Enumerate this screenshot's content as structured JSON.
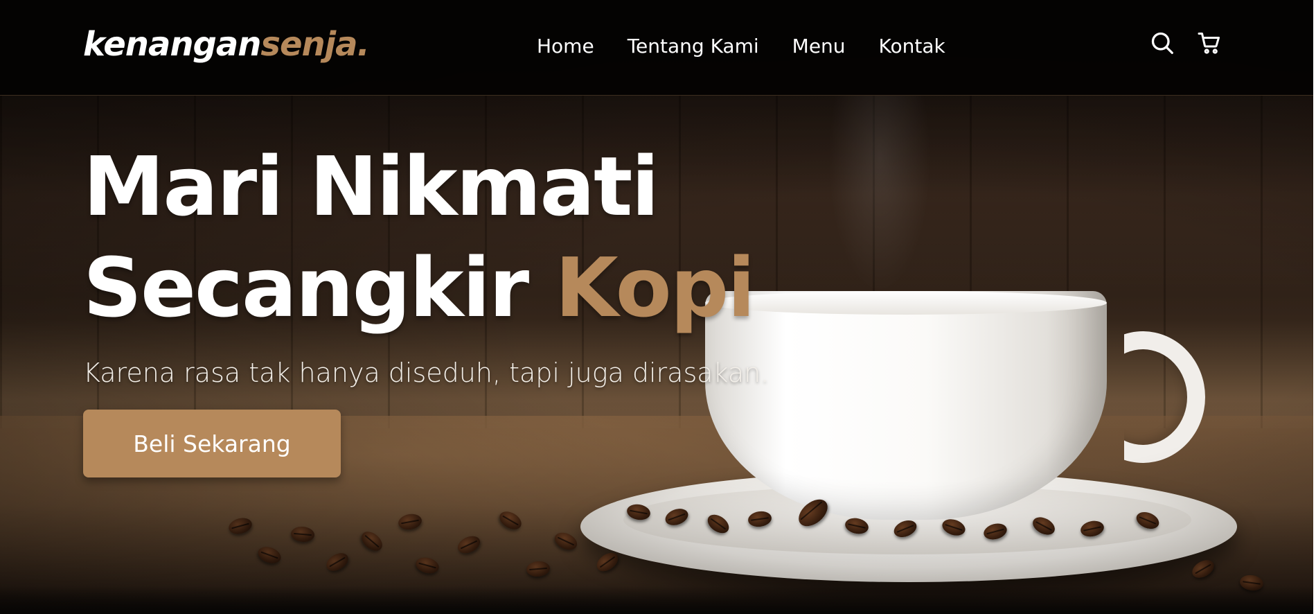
{
  "brand": {
    "name_main": "kenangan",
    "name_accent": "senja",
    "name_dot": ".",
    "accent_color": "#b6895b"
  },
  "nav": {
    "items": [
      {
        "label": "Home"
      },
      {
        "label": "Tentang Kami"
      },
      {
        "label": "Menu"
      },
      {
        "label": "Kontak"
      }
    ],
    "icons": [
      "search-icon",
      "shopping-cart-icon"
    ]
  },
  "hero": {
    "headline_line1": "Mari Nikmati",
    "headline_line2_main": "Secangkir ",
    "headline_line2_accent": "Kopi",
    "subtitle": "Karena rasa tak hanya diseduh, tapi juga dirasakan.",
    "cta_label": "Beli Sekarang"
  }
}
